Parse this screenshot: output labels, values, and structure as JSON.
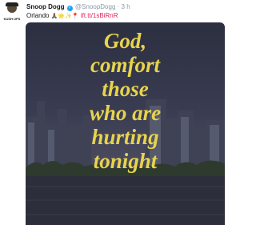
{
  "tweet": {
    "name": "Snoop Dogg",
    "handle": "@SnoopDogg",
    "separator": "·",
    "time": "3 h",
    "text": "Orlando",
    "emojis": [
      "🙏🏾",
      "🌟",
      "✨",
      "📍"
    ],
    "link": "ift.tt/1sBiRnR",
    "avatar_label": "KUSH UPS",
    "verified_glyph": "✓"
  },
  "image": {
    "quote_lines": [
      "God,",
      "comfort",
      "those",
      "who are",
      "hurting",
      "tonight"
    ],
    "text_color": "#e8d44c"
  },
  "colors": {
    "verified": "#1da1f2",
    "link": "#e0245e",
    "muted": "#8899a6"
  }
}
